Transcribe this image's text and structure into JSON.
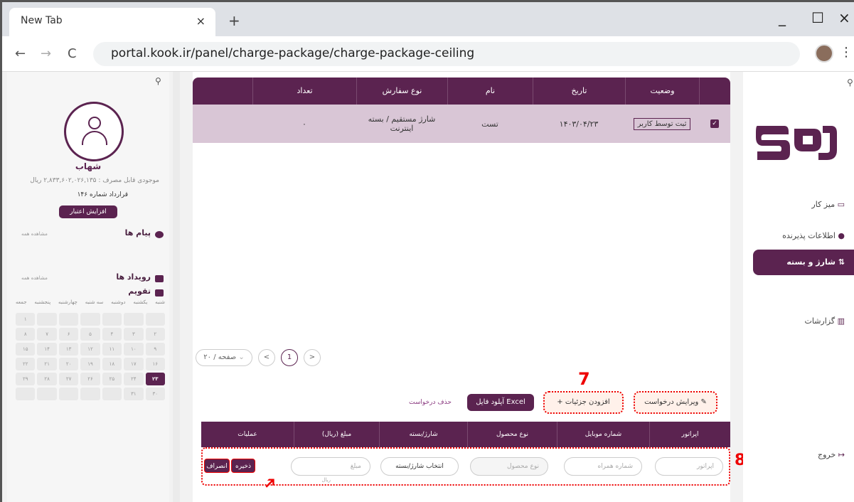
{
  "browser": {
    "tab_title": "New Tab",
    "tab_close": "×",
    "new_tab": "+",
    "url": "portal.kook.ir/panel/charge-package/charge-package-ceiling",
    "back": "←",
    "forward": "→",
    "reload": "C",
    "menu": "⋮",
    "minimize": "_",
    "maximize": "☐",
    "close": "×"
  },
  "left_panel": {
    "pin": "⚲",
    "username": "شهاب",
    "balance": "موجودی قابل مصرف : ۲,۸۳۳,۶۰۲,۰۲۶,۱۳۵ ریال",
    "contract": "قرارداد شماره ۱۴۶",
    "credit_button": "افزایش اعتبار",
    "messages_title": "پیام ها",
    "messages_see_all": "مشاهده همه",
    "events_title": "رویداد ها",
    "events_see_all": "مشاهده همه",
    "calendar_title": "تقویم",
    "weekdays": [
      "شنبه",
      "یکشنبه",
      "دوشنبه",
      "سه شنبه",
      "چهارشنبه",
      "پنجشنبه",
      "جمعه"
    ],
    "calendar_cells": [
      "",
      "",
      "",
      "",
      "",
      "",
      "۱",
      "۲",
      "۳",
      "۴",
      "۵",
      "۶",
      "۷",
      "۸",
      "۹",
      "۱۰",
      "۱۱",
      "۱۲",
      "۱۳",
      "۱۴",
      "۱۵",
      "۱۶",
      "۱۷",
      "۱۸",
      "۱۹",
      "۲۰",
      "۲۱",
      "۲۲",
      "۲۳",
      "۲۴",
      "۲۵",
      "۲۶",
      "۲۷",
      "۲۸",
      "۲۹",
      "۳۰",
      "۳۱",
      "",
      "",
      "",
      "",
      ""
    ],
    "today": "۲۳"
  },
  "main": {
    "columns": [
      "",
      "وضعیت",
      "تاریخ",
      "نام",
      "نوع سفارش",
      "تعداد",
      ""
    ],
    "row": {
      "checkbox": "✓",
      "status": "ثبت توسط کاربر",
      "date": "۱۴۰۳/۰۴/۲۳",
      "name": "تست",
      "order_type": "شارژ مستقیم / بسته اینترنت",
      "count": "۰"
    },
    "pager": {
      "prev": "<",
      "page": "1",
      "next": ">",
      "page_size": "۲۰ / صفحه"
    },
    "actions": {
      "edit_request": "ویرایش درخواست",
      "add_details": "+ افزودن جزئیات",
      "upload_excel": "آپلود فایل Excel",
      "delete_request": "حذف درخواست"
    },
    "callouts": {
      "first": "7",
      "second": "8"
    },
    "detail_columns": [
      "اپراتور",
      "شماره موبایل",
      "نوع محصول",
      "شارژ/بسته",
      "مبلغ (ریال)",
      "عملیات"
    ],
    "form": {
      "operator_placeholder": "اپراتور",
      "mobile_placeholder": "شماره همراه",
      "product_placeholder": "نوع محصول",
      "charge_select": "انتخاب شارژ/بسته",
      "amount_placeholder": "مبلغ",
      "amount_unit": "ریال",
      "save": "ذخیره",
      "cancel": "انصراف"
    }
  },
  "right_nav": {
    "pin": "⚲",
    "items": [
      "میز کار",
      "اطلاعات پذیرنده",
      "شارژ و بسته",
      "گزارشات"
    ],
    "logout": "خروج"
  },
  "colors": {
    "brand": "#5b2350",
    "highlight": "#e00000"
  }
}
